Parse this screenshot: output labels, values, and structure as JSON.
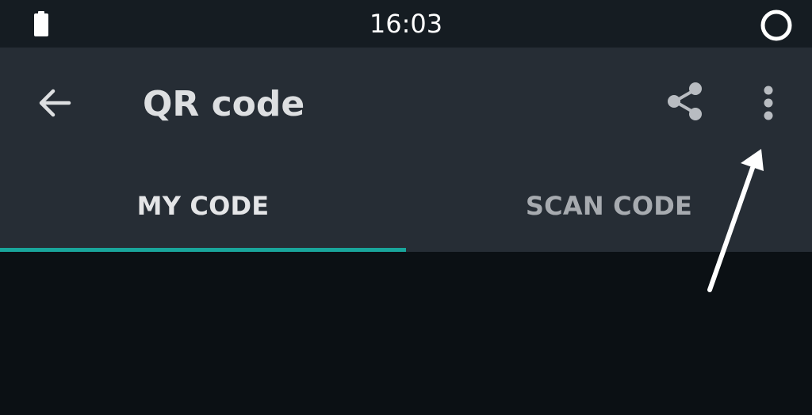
{
  "status_bar": {
    "time": "16:03",
    "battery_icon": "battery-full-icon",
    "right_icon": "circle-icon"
  },
  "app_bar": {
    "title": "QR code",
    "back_icon": "arrow-back-icon",
    "share_icon": "share-icon",
    "overflow_icon": "more-vertical-icon"
  },
  "tabs": [
    {
      "label": "MY CODE",
      "selected": true
    },
    {
      "label": "SCAN CODE",
      "selected": false
    }
  ],
  "colors": {
    "status_bar_bg": "#151c22",
    "app_bar_bg": "#262d35",
    "content_bg": "#0b1014",
    "tab_indicator": "#19a59b",
    "annotation_arrow": "#ffffff"
  },
  "annotation": {
    "icon": "annotation-arrow",
    "points_to": "overflow-menu-button"
  }
}
